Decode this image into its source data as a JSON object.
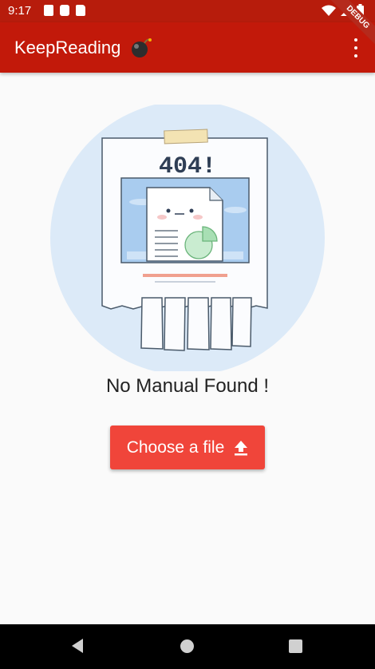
{
  "status_bar": {
    "time": "9:17",
    "icons_left": [
      "image-icon",
      "flipboard-icon",
      "sd-card-icon"
    ],
    "icons_right": [
      "wifi-icon",
      "signal-icon",
      "battery-icon"
    ]
  },
  "app_bar": {
    "title": "KeepReading",
    "emoji": "bomb-icon",
    "menu_icon": "more-vert-icon",
    "debug_banner": "DEBUG"
  },
  "illustration": {
    "heading": "404!"
  },
  "main": {
    "message": "No Manual Found !",
    "button_label": "Choose a file",
    "button_icon": "upload-icon"
  },
  "colors": {
    "status_bar": "#b71c0c",
    "app_bar": "#c2190a",
    "button": "#f0453a",
    "illustration_bg": "#dceaf8"
  },
  "nav_bar": {
    "buttons": [
      "back-icon",
      "home-icon",
      "recents-icon"
    ]
  }
}
